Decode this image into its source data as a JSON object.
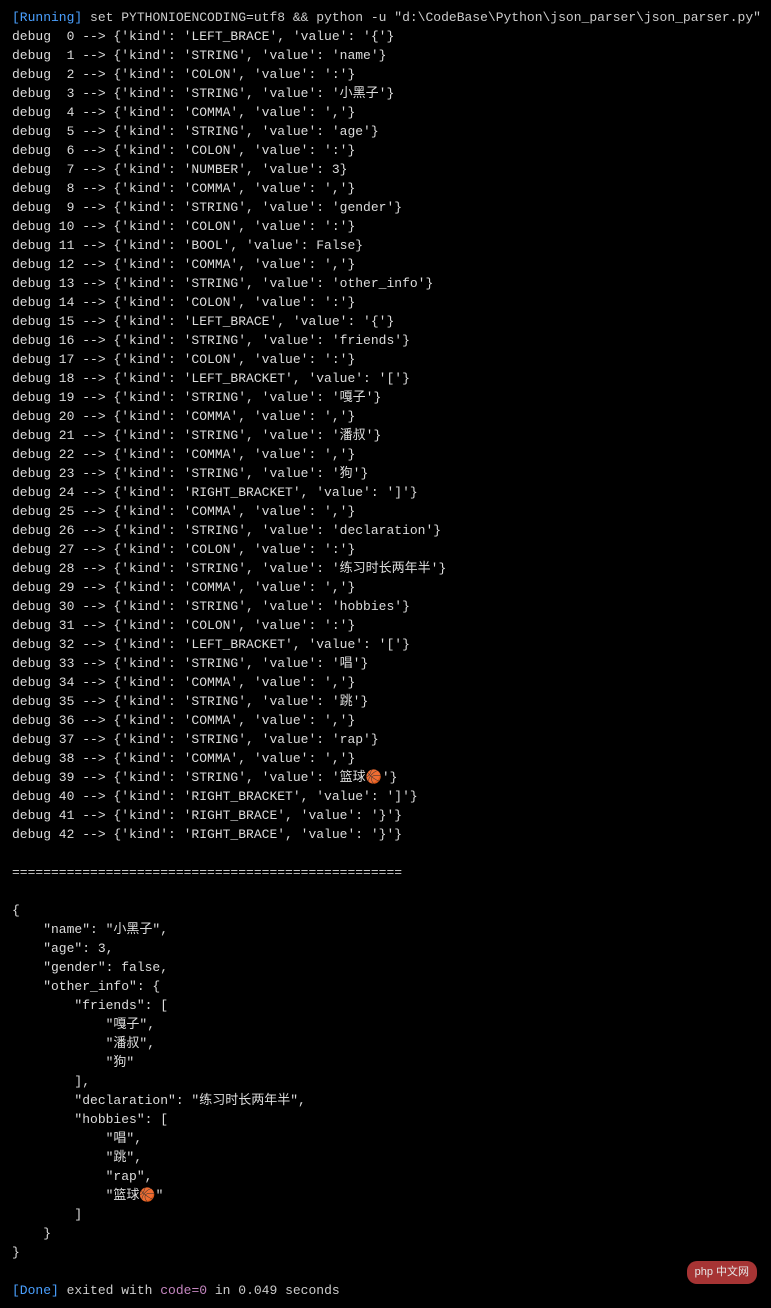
{
  "header": {
    "running_label": "[Running]",
    "command": "set PYTHONIOENCODING=utf8 && python -u \"d:\\CodeBase\\Python\\json_parser\\json_parser.py\""
  },
  "debug_lines": [
    {
      "idx": " 0",
      "kind": "LEFT_BRACE",
      "value": "'{'"
    },
    {
      "idx": " 1",
      "kind": "STRING",
      "value": "'name'"
    },
    {
      "idx": " 2",
      "kind": "COLON",
      "value": "':'"
    },
    {
      "idx": " 3",
      "kind": "STRING",
      "value": "'小黑子'"
    },
    {
      "idx": " 4",
      "kind": "COMMA",
      "value": "','"
    },
    {
      "idx": " 5",
      "kind": "STRING",
      "value": "'age'"
    },
    {
      "idx": " 6",
      "kind": "COLON",
      "value": "':'"
    },
    {
      "idx": " 7",
      "kind": "NUMBER",
      "value": "3"
    },
    {
      "idx": " 8",
      "kind": "COMMA",
      "value": "','"
    },
    {
      "idx": " 9",
      "kind": "STRING",
      "value": "'gender'"
    },
    {
      "idx": "10",
      "kind": "COLON",
      "value": "':'"
    },
    {
      "idx": "11",
      "kind": "BOOL",
      "value": "False"
    },
    {
      "idx": "12",
      "kind": "COMMA",
      "value": "','"
    },
    {
      "idx": "13",
      "kind": "STRING",
      "value": "'other_info'"
    },
    {
      "idx": "14",
      "kind": "COLON",
      "value": "':'"
    },
    {
      "idx": "15",
      "kind": "LEFT_BRACE",
      "value": "'{'"
    },
    {
      "idx": "16",
      "kind": "STRING",
      "value": "'friends'"
    },
    {
      "idx": "17",
      "kind": "COLON",
      "value": "':'"
    },
    {
      "idx": "18",
      "kind": "LEFT_BRACKET",
      "value": "'['"
    },
    {
      "idx": "19",
      "kind": "STRING",
      "value": "'嘎子'"
    },
    {
      "idx": "20",
      "kind": "COMMA",
      "value": "','"
    },
    {
      "idx": "21",
      "kind": "STRING",
      "value": "'潘叔'"
    },
    {
      "idx": "22",
      "kind": "COMMA",
      "value": "','"
    },
    {
      "idx": "23",
      "kind": "STRING",
      "value": "'狗'"
    },
    {
      "idx": "24",
      "kind": "RIGHT_BRACKET",
      "value": "']'"
    },
    {
      "idx": "25",
      "kind": "COMMA",
      "value": "','"
    },
    {
      "idx": "26",
      "kind": "STRING",
      "value": "'declaration'"
    },
    {
      "idx": "27",
      "kind": "COLON",
      "value": "':'"
    },
    {
      "idx": "28",
      "kind": "STRING",
      "value": "'练习时长两年半'"
    },
    {
      "idx": "29",
      "kind": "COMMA",
      "value": "','"
    },
    {
      "idx": "30",
      "kind": "STRING",
      "value": "'hobbies'"
    },
    {
      "idx": "31",
      "kind": "COLON",
      "value": "':'"
    },
    {
      "idx": "32",
      "kind": "LEFT_BRACKET",
      "value": "'['"
    },
    {
      "idx": "33",
      "kind": "STRING",
      "value": "'唱'"
    },
    {
      "idx": "34",
      "kind": "COMMA",
      "value": "','"
    },
    {
      "idx": "35",
      "kind": "STRING",
      "value": "'跳'"
    },
    {
      "idx": "36",
      "kind": "COMMA",
      "value": "','"
    },
    {
      "idx": "37",
      "kind": "STRING",
      "value": "'rap'"
    },
    {
      "idx": "38",
      "kind": "COMMA",
      "value": "','"
    },
    {
      "idx": "39",
      "kind": "STRING",
      "value": "'篮球🏀'"
    },
    {
      "idx": "40",
      "kind": "RIGHT_BRACKET",
      "value": "']'"
    },
    {
      "idx": "41",
      "kind": "RIGHT_BRACE",
      "value": "'}'"
    },
    {
      "idx": "42",
      "kind": "RIGHT_BRACE",
      "value": "'}'"
    }
  ],
  "separator": "==================================================",
  "json_output": [
    "{",
    "    \"name\": \"小黑子\",",
    "    \"age\": 3,",
    "    \"gender\": false,",
    "    \"other_info\": {",
    "        \"friends\": [",
    "            \"嘎子\",",
    "            \"潘叔\",",
    "            \"狗\"",
    "        ],",
    "        \"declaration\": \"练习时长两年半\",",
    "        \"hobbies\": [",
    "            \"唱\",",
    "            \"跳\",",
    "            \"rap\",",
    "            \"篮球🏀\"",
    "        ]",
    "    }",
    "}"
  ],
  "footer": {
    "done_label": "[Done]",
    "prefix": " exited with ",
    "code_label": "code=",
    "code_value": "0",
    "suffix": " in 0.049 seconds"
  },
  "watermark": "php 中文网"
}
